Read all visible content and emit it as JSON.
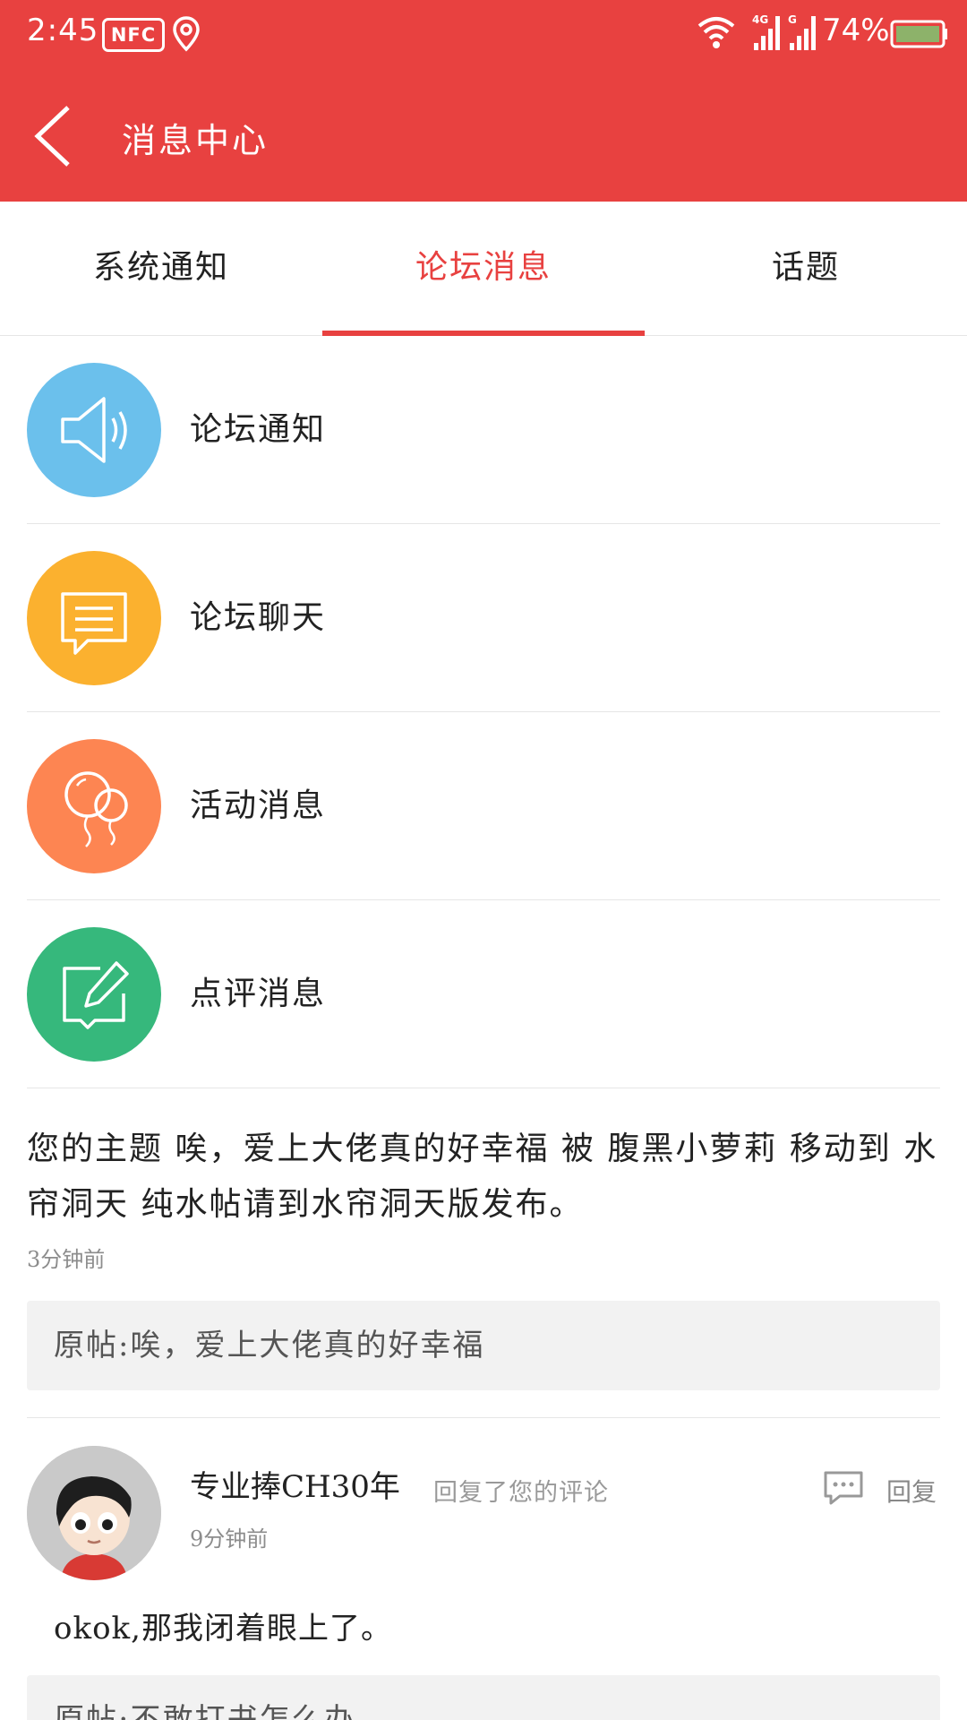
{
  "status_bar": {
    "time": "2:45",
    "nfc": "NFC",
    "battery_percent": "74%"
  },
  "header": {
    "title": "消息中心"
  },
  "tabs": [
    {
      "label": "系统通知",
      "active": false
    },
    {
      "label": "论坛消息",
      "active": true
    },
    {
      "label": "话题",
      "active": false
    }
  ],
  "menu": [
    {
      "label": "论坛通知",
      "icon": "speaker-icon",
      "color": "#6bc0ec"
    },
    {
      "label": "论坛聊天",
      "icon": "chat-icon",
      "color": "#fbb12f"
    },
    {
      "label": "活动消息",
      "icon": "balloon-icon",
      "color": "#fd8552"
    },
    {
      "label": "点评消息",
      "icon": "edit-icon",
      "color": "#36b87c"
    }
  ],
  "notice": {
    "text": "您的主题 唉，爱上大佬真的好幸福 被 腹黑小萝莉 移动到 水帘洞天 纯水帖请到水帘洞天版发布。",
    "time": "3分钟前",
    "original": "原帖:唉，爱上大佬真的好幸福"
  },
  "reply": {
    "user": "专业捧CH30年",
    "action": "回复了您的评论",
    "time": "9分钟前",
    "reply_label": "回复",
    "content": "okok,那我闭着眼上了。",
    "original": "原帖:不敢打书怎么办"
  },
  "colors": {
    "brand": "#e84140",
    "divider": "#e6e6e6",
    "quote_bg": "#f2f2f2"
  }
}
